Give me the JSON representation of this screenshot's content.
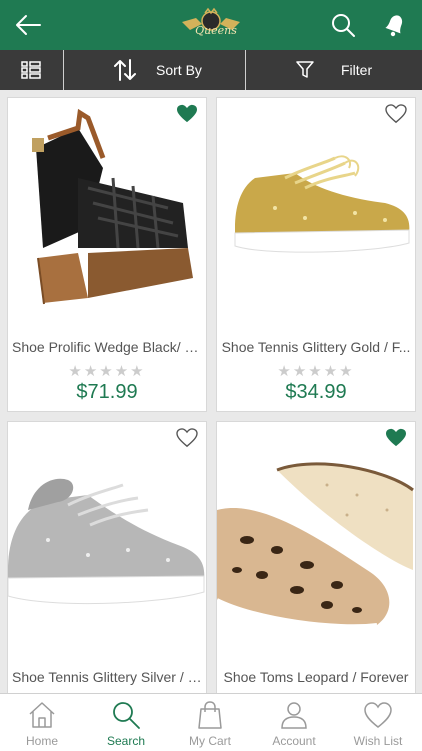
{
  "header": {
    "logo_text": "Queens"
  },
  "toolbar": {
    "sort_label": "Sort By",
    "filter_label": "Filter"
  },
  "products": [
    {
      "name": "Shoe Prolific Wedge Black/ V...",
      "rating_stars": "★★★★★",
      "rating": 0,
      "price": "$71.99",
      "wishlisted": true
    },
    {
      "name": "Shoe Tennis Glittery Gold / F...",
      "rating_stars": "★★★★★",
      "rating": 0,
      "price": "$34.99",
      "wishlisted": false
    },
    {
      "name": "Shoe Tennis Glittery Silver / F...",
      "wishlisted": false
    },
    {
      "name": "Shoe Toms Leopard / Forever",
      "wishlisted": true
    }
  ],
  "bottom_nav": [
    {
      "label": "Home",
      "icon": "home-icon",
      "active": false
    },
    {
      "label": "Search",
      "icon": "search-icon",
      "active": true
    },
    {
      "label": "My Cart",
      "icon": "bag-icon",
      "active": false
    },
    {
      "label": "Account",
      "icon": "user-icon",
      "active": false
    },
    {
      "label": "Wish List",
      "icon": "heart-icon",
      "active": false
    }
  ],
  "colors": {
    "brand_green": "#1f7a52",
    "toolbar_dark": "#3a3a3a",
    "inactive_gray": "#9a9a9a"
  }
}
